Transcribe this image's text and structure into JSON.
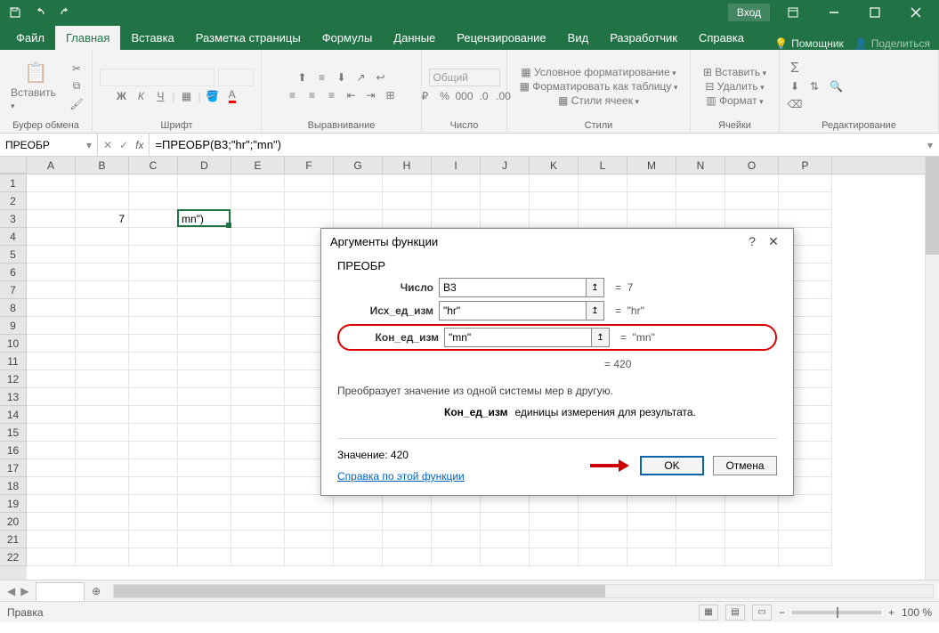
{
  "titlebar": {
    "login": "Вход"
  },
  "tabs": [
    "Файл",
    "Главная",
    "Вставка",
    "Разметка страницы",
    "Формулы",
    "Данные",
    "Рецензирование",
    "Вид",
    "Разработчик",
    "Справка"
  ],
  "active_tab_index": 1,
  "ribbon_right": {
    "help": "Помощник",
    "share": "Поделиться"
  },
  "groups": {
    "clipboard": {
      "paste": "Вставить",
      "label": "Буфер обмена"
    },
    "font": {
      "label": "Шрифт",
      "bold": "Ж",
      "italic": "К",
      "underline": "Ч"
    },
    "alignment": {
      "label": "Выравнивание"
    },
    "number": {
      "label": "Число",
      "format": "Общий"
    },
    "styles": {
      "label": "Стили",
      "cond": "Условное форматирование",
      "table": "Форматировать как таблицу",
      "cell": "Стили ячеек"
    },
    "cells": {
      "label": "Ячейки",
      "insert": "Вставить",
      "delete": "Удалить",
      "format": "Формат"
    },
    "editing": {
      "label": "Редактирование"
    }
  },
  "namebox": "ПРЕОБР",
  "formula": "=ПРЕОБР(B3;\"hr\";\"mn\")",
  "columns": [
    "A",
    "B",
    "C",
    "D",
    "E",
    "F",
    "G",
    "H",
    "I",
    "J",
    "K",
    "L",
    "M",
    "N",
    "O",
    "P"
  ],
  "row_count": 22,
  "cells": {
    "B3": "7",
    "D3": "mn\")"
  },
  "active_cell": {
    "col": "D",
    "row": 3
  },
  "dialog": {
    "title": "Аргументы функции",
    "function": "ПРЕОБР",
    "args": [
      {
        "label": "Число",
        "value": "B3",
        "result": "7",
        "highlight": false
      },
      {
        "label": "Исх_ед_изм",
        "value": "\"hr\"",
        "result": "\"hr\"",
        "highlight": false
      },
      {
        "label": "Кон_ед_изм",
        "value": "\"mn\"",
        "result": "\"mn\"",
        "highlight": true
      }
    ],
    "computed": "420",
    "description": "Преобразует значение из одной системы мер в другую.",
    "param_label": "Кон_ед_изм",
    "param_desc": "единицы измерения для результата.",
    "value_label": "Значение:",
    "value": "420",
    "help_link": "Справка по этой функции",
    "ok": "OK",
    "cancel": "Отмена"
  },
  "status": {
    "mode": "Правка",
    "zoom": "100 %"
  }
}
